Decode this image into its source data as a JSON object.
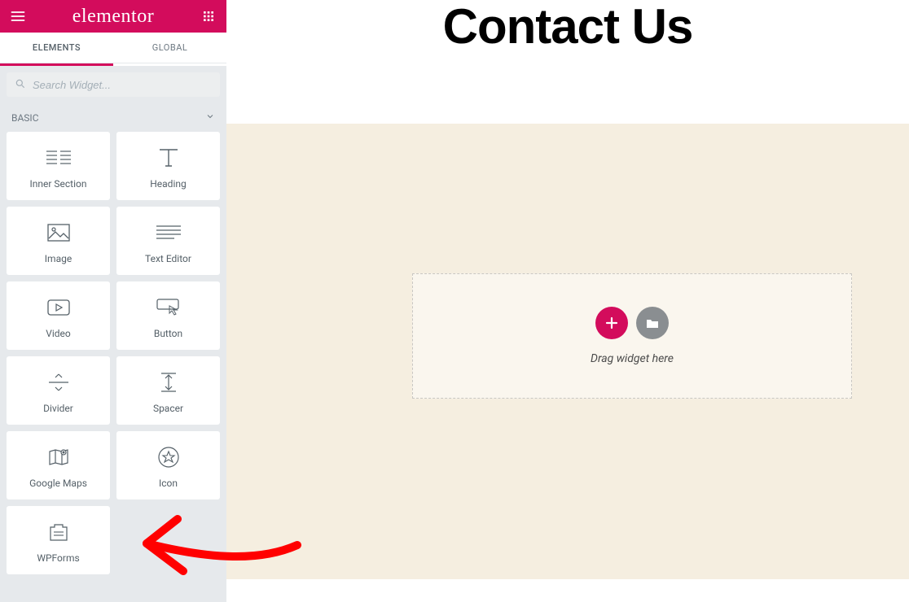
{
  "sidebar": {
    "brand": "elementor",
    "tabs": {
      "elements": "ELEMENTS",
      "global": "GLOBAL"
    },
    "search": {
      "placeholder": "Search Widget..."
    },
    "category": "BASIC",
    "widgets": [
      {
        "label": "Inner Section"
      },
      {
        "label": "Heading"
      },
      {
        "label": "Image"
      },
      {
        "label": "Text Editor"
      },
      {
        "label": "Video"
      },
      {
        "label": "Button"
      },
      {
        "label": "Divider"
      },
      {
        "label": "Spacer"
      },
      {
        "label": "Google Maps"
      },
      {
        "label": "Icon"
      },
      {
        "label": "WPForms"
      }
    ]
  },
  "main": {
    "page_title": "Contact Us",
    "drop_hint": "Drag widget here"
  },
  "colors": {
    "accent": "#d30c5c",
    "sidebar_bg": "#e6e9ec",
    "canvas_bg": "#f5eee0"
  }
}
